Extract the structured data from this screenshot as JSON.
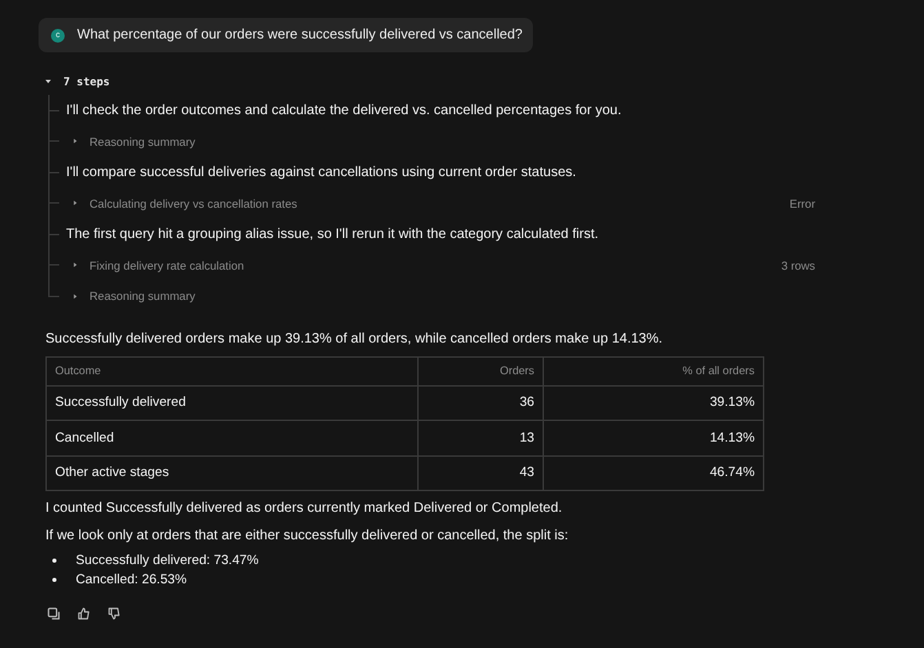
{
  "question": {
    "avatar_letter": "c",
    "text": "What percentage of our orders were successfully delivered vs cancelled?"
  },
  "steps": {
    "label": "7 steps",
    "expanded": true,
    "items": [
      {
        "kind": "message",
        "text": "I'll check the order outcomes and calculate the delivered vs. cancelled percentages for you."
      },
      {
        "kind": "tool",
        "label": "Reasoning summary",
        "expanded": false
      },
      {
        "kind": "message",
        "text": "I'll compare successful deliveries against cancellations using current order statuses."
      },
      {
        "kind": "tool",
        "label": "Calculating delivery vs cancellation rates",
        "status": "Error",
        "expanded": false
      },
      {
        "kind": "message",
        "text": "The first query hit a grouping alias issue, so I'll rerun it with the category calculated first."
      },
      {
        "kind": "tool",
        "label": "Fixing delivery rate calculation",
        "status": "3 rows",
        "expanded": false
      },
      {
        "kind": "tool",
        "label": "Reasoning summary",
        "expanded": false
      }
    ]
  },
  "answer": {
    "summary": "Successfully delivered orders make up 39.13% of all orders, while cancelled orders make up 14.13%.",
    "table": {
      "columns": [
        "Outcome",
        "Orders",
        "% of all orders"
      ],
      "rows": [
        [
          "Successfully delivered",
          "36",
          "39.13%"
        ],
        [
          "Cancelled",
          "13",
          "14.13%"
        ],
        [
          "Other active stages",
          "43",
          "46.74%"
        ]
      ]
    },
    "notes": [
      "I counted Successfully delivered as orders currently marked Delivered or Completed.",
      "If we look only at orders that are either successfully delivered or cancelled, the split is:"
    ],
    "bullets": [
      "Successfully delivered: 73.47%",
      "Cancelled: 26.53%"
    ]
  }
}
